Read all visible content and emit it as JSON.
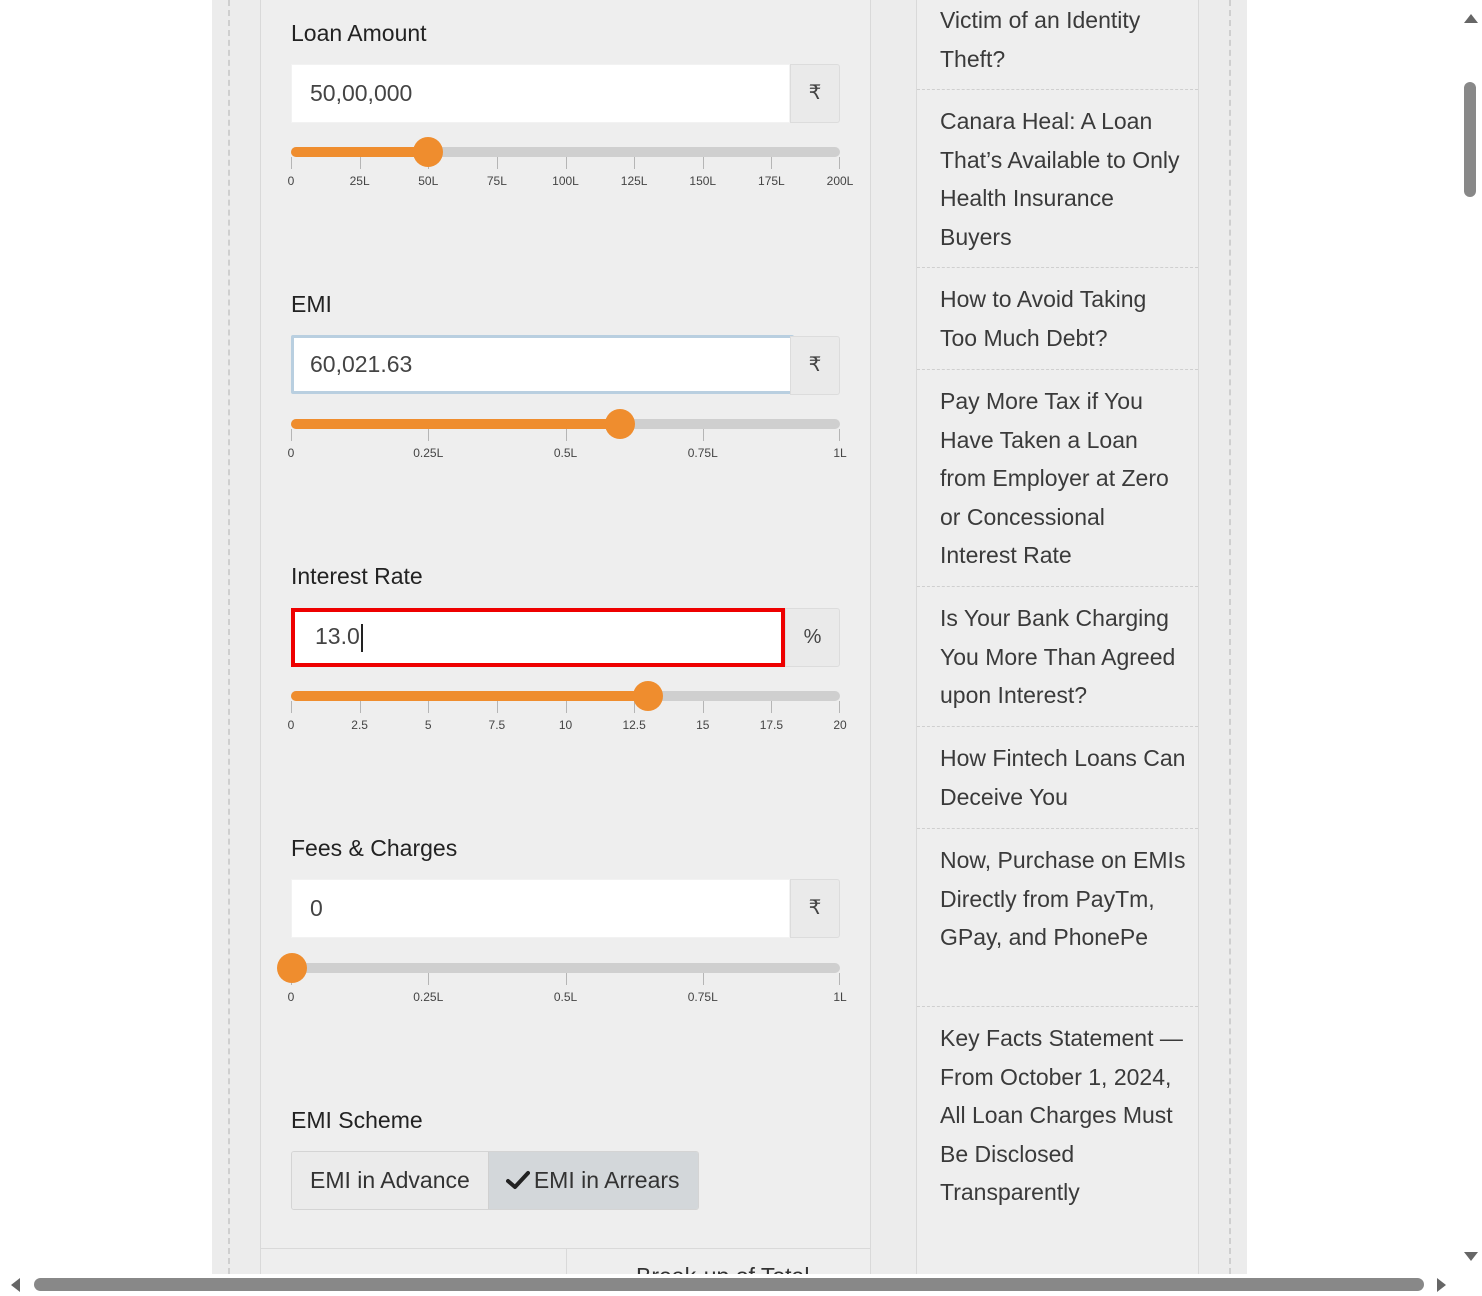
{
  "loan_amount": {
    "label": "Loan Amount",
    "value": "50,00,000",
    "addon": "₹",
    "slider_fraction": 0.25,
    "ticks": [
      "0",
      "25L",
      "50L",
      "75L",
      "100L",
      "125L",
      "150L",
      "175L",
      "200L"
    ]
  },
  "emi": {
    "label": "EMI",
    "value": "60,021.63",
    "addon": "₹",
    "slider_fraction": 0.6,
    "ticks": [
      "0",
      "0.25L",
      "0.5L",
      "0.75L",
      "1L"
    ]
  },
  "interest_rate": {
    "label": "Interest Rate",
    "value": "13.0",
    "addon": "%",
    "slider_fraction": 0.65,
    "ticks": [
      "0",
      "2.5",
      "5",
      "7.5",
      "10",
      "12.5",
      "15",
      "17.5",
      "20"
    ]
  },
  "fees_charges": {
    "label": "Fees & Charges",
    "value": "0",
    "addon": "₹",
    "slider_fraction": 0.0,
    "ticks": [
      "0",
      "0.25L",
      "0.5L",
      "0.75L",
      "1L"
    ]
  },
  "emi_scheme": {
    "label": "EMI Scheme",
    "options": [
      "EMI in Advance",
      "EMI in Arrears"
    ],
    "selected": "EMI in Arrears"
  },
  "bottom_partial_text": "Break-up of Total",
  "sidebar_articles": [
    "Victim of an Identity Theft?",
    "Canara Heal: A Loan That’s Available to Only Health Insurance Buyers",
    "How to Avoid Taking Too Much Debt?",
    "Pay More Tax if You Have Taken a Loan from Employer at Zero or Concessional Interest Rate",
    "Is Your Bank Charging You More Than Agreed upon Interest?",
    "How Fintech Loans Can Deceive You",
    "Now, Purchase on EMIs Directly from PayTm, GPay, and PhonePe",
    "Key Facts Statement — From October 1, 2024, All Loan Charges Must Be Disclosed Transparently"
  ],
  "colors": {
    "accent": "#ef8d2e",
    "highlight_border": "#ee0000",
    "panel_bg": "#eeeeee"
  }
}
